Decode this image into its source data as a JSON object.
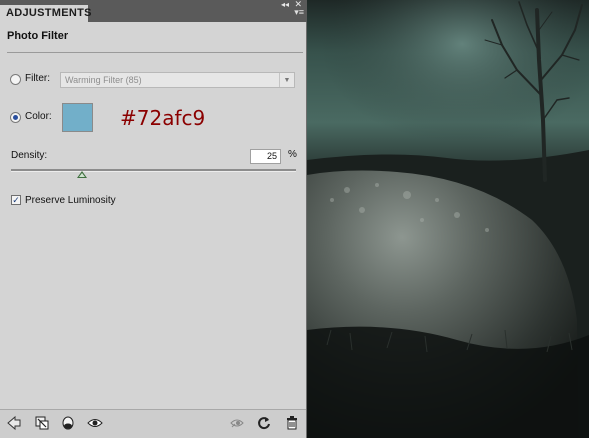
{
  "panel": {
    "tab_label": "ADJUSTMENTS",
    "collapse_glyph": "◂◂",
    "close_glyph": "✕",
    "menu_glyph": "▾≡",
    "title": "Photo Filter",
    "filter_label": "Filter:",
    "filter_value": "Warming Filter (85)",
    "filter_selected": false,
    "color_label": "Color:",
    "color_selected": true,
    "color_value": "#72afc9",
    "color_annotation": "#72afc9",
    "density_label": "Density:",
    "density_value": "25",
    "density_unit": "%",
    "density_fraction": 0.25,
    "preserve_label": "Preserve Luminosity",
    "preserve_checked": true
  },
  "footer_icons": [
    "back-arrow-icon",
    "clip-to-layer-icon",
    "layer-visibility-mask-icon",
    "eye-icon",
    "view-previous-state-icon",
    "reset-icon",
    "trash-icon"
  ],
  "colors": {
    "panel_bg": "#d4d4d4",
    "tabstrip_bg": "#5a5a5a",
    "annotation_red": "#8b0000"
  }
}
